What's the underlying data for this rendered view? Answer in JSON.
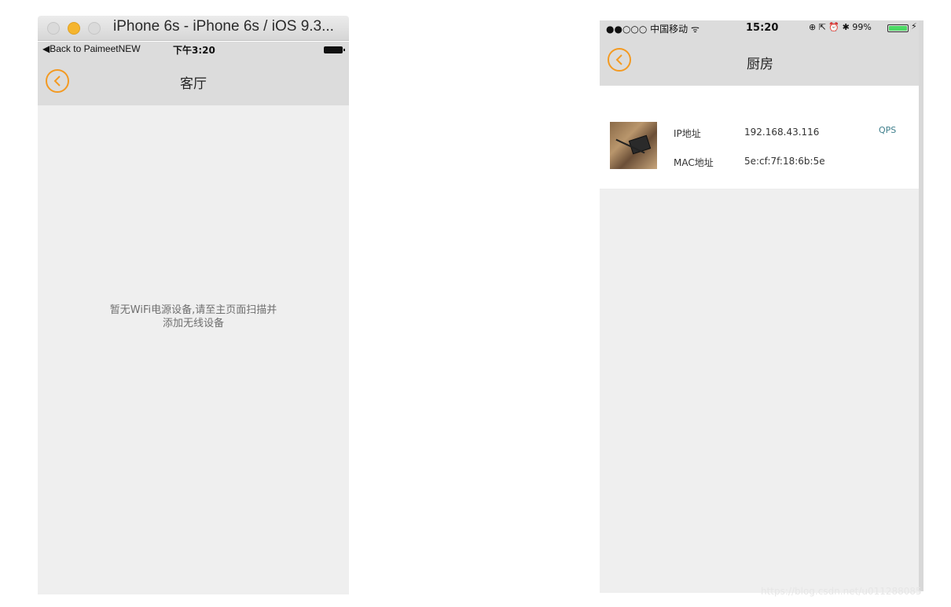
{
  "left_screen": {
    "window_title": "iPhone 6s - iPhone 6s / iOS 9.3...",
    "status": {
      "back_to_app": "◀Back to PaimeetNEW",
      "time": "下午3:20"
    },
    "nav": {
      "title": "客厅"
    },
    "empty_message": "暂无WiFi电源设备,请至主页面扫描并添加无线设备"
  },
  "right_screen": {
    "status": {
      "carrier": "●●○○○ 中国移动 ᯤ",
      "time": "15:20",
      "right_icons": "⊕ ⇱ ⏰ ✱ 99%",
      "battery_level": 0.99,
      "charging": "⚡"
    },
    "nav": {
      "title": "厨房"
    },
    "device": {
      "ip_label": "IP地址",
      "ip_value": "192.168.43.116",
      "mac_label": "MAC地址",
      "mac_value": "5e:cf:7f:18:6b:5e",
      "type_badge": "QPS"
    }
  },
  "watermark": "https://blog.csdn.net/u011288085",
  "colors": {
    "accent": "#f39a22",
    "nav_bg": "#dcdcdc",
    "body_bg": "#efefef",
    "badge": "#3f7f8c",
    "battery": "#4cd964"
  }
}
